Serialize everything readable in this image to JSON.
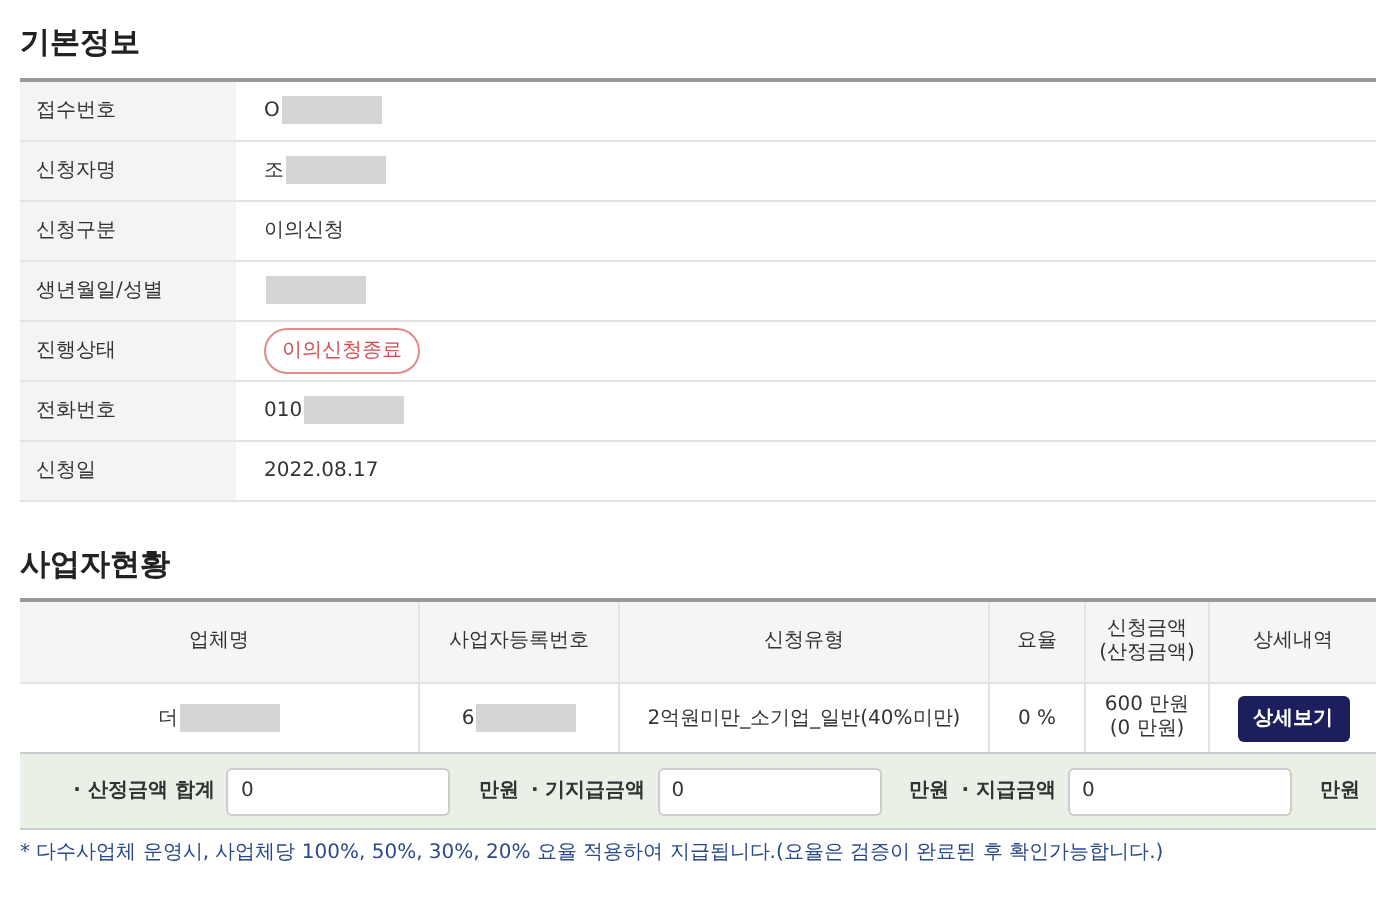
{
  "basic_info": {
    "title": "기본정보",
    "rows": [
      {
        "label": "접수번호",
        "value": "O",
        "redacted": true,
        "kind": "text"
      },
      {
        "label": "신청자명",
        "value": "조",
        "redacted": true,
        "kind": "text"
      },
      {
        "label": "신청구분",
        "value": "이의신청",
        "redacted": false,
        "kind": "text"
      },
      {
        "label": "생년월일/성별",
        "redacted": true,
        "kind": "text"
      },
      {
        "label": "진행상태",
        "value": "이의신청종료",
        "redacted": false,
        "kind": "badge"
      },
      {
        "label": "전화번호",
        "value": "010",
        "redacted": true,
        "kind": "text"
      },
      {
        "label": "신청일",
        "value": "2022.08.17",
        "redacted": false,
        "kind": "text"
      }
    ]
  },
  "business": {
    "title": "사업자현황",
    "columns": [
      "업체명",
      "사업자등록번호",
      "신청유형",
      "요율",
      "신청금액\n(산정금액)",
      "상세내역"
    ],
    "rows": [
      {
        "company": "더",
        "company_redacted": true,
        "reg_no": "6",
        "reg_no_redacted": true,
        "type": "2억원미만_소기업_일반(40%미만)",
        "rate": "0 %",
        "amount": "600 만원\n(0 만원)",
        "detail_button": "상세보기"
      }
    ],
    "totals": [
      {
        "label": "· 산정금액 합계",
        "value": "0",
        "unit": "만원"
      },
      {
        "label": "· 기지급금액",
        "value": "0",
        "unit": "만원"
      },
      {
        "label": "· 지급금액",
        "value": "0",
        "unit": "만원"
      }
    ],
    "note": "* 다수사업체 운영시, 사업체당 100%, 50%, 30%, 20% 요율 적용하여 지급됩니다.(요율은 검증이 완료된 후 확인가능합니다.)"
  }
}
